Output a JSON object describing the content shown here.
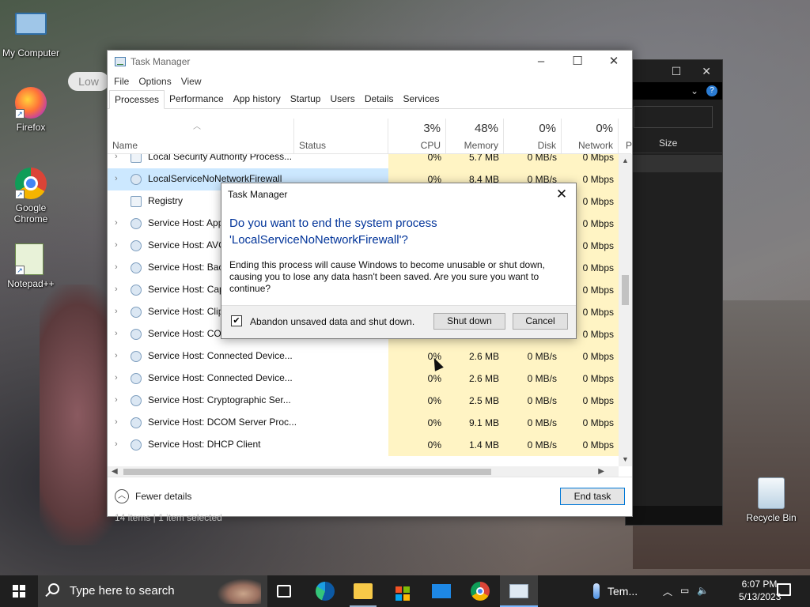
{
  "desktop": {
    "icons": [
      {
        "label": "My Computer",
        "icon": "computer-icon"
      },
      {
        "label": "Firefox",
        "icon": "firefox-icon"
      },
      {
        "label": "Google Chrome",
        "icon": "chrome-icon"
      },
      {
        "label": "Notepad++",
        "icon": "notepad-plus-plus-icon"
      },
      {
        "label": "Recycle Bin",
        "icon": "recycle-bin-icon"
      }
    ],
    "low_pill": "Low"
  },
  "bg_window": {
    "column_header": "Size"
  },
  "task_manager": {
    "title": "Task Manager",
    "menu": [
      "File",
      "Options",
      "View"
    ],
    "tabs": [
      "Processes",
      "Performance",
      "App history",
      "Startup",
      "Users",
      "Details",
      "Services"
    ],
    "active_tab": "Processes",
    "columns": {
      "name": "Name",
      "status": "Status",
      "cpu": {
        "pct": "3%",
        "label": "CPU"
      },
      "memory": {
        "pct": "48%",
        "label": "Memory"
      },
      "disk": {
        "pct": "0%",
        "label": "Disk"
      },
      "network": {
        "pct": "0%",
        "label": "Network"
      },
      "power": "P"
    },
    "rows": [
      {
        "name": "Local Security Authority Process...",
        "cpu": "0%",
        "memory": "5.7 MB",
        "disk": "0 MB/s",
        "network": "0 Mbps"
      },
      {
        "name": "LocalServiceNoNetworkFirewall",
        "cpu": "0%",
        "memory": "8.4 MB",
        "disk": "0 MB/s",
        "network": "0 Mbps"
      },
      {
        "name": "Registry",
        "cpu": "",
        "memory": "",
        "disk": "",
        "network": "0 Mbps"
      },
      {
        "name": "Service Host: App",
        "cpu": "",
        "memory": "",
        "disk": "",
        "network": "0 Mbps"
      },
      {
        "name": "Service Host: AVC",
        "cpu": "",
        "memory": "",
        "disk": "",
        "network": "0 Mbps"
      },
      {
        "name": "Service Host: Bac",
        "cpu": "",
        "memory": "",
        "disk": "",
        "network": "0 Mbps"
      },
      {
        "name": "Service Host: Cap",
        "cpu": "",
        "memory": "",
        "disk": "",
        "network": "0 Mbps"
      },
      {
        "name": "Service Host: Clip",
        "cpu": "",
        "memory": "",
        "disk": "",
        "network": "0 Mbps"
      },
      {
        "name": "Service Host: COM",
        "cpu": "",
        "memory": "",
        "disk": "",
        "network": "0 Mbps"
      },
      {
        "name": "Service Host: Connected Device...",
        "cpu": "0%",
        "memory": "2.6 MB",
        "disk": "0 MB/s",
        "network": "0 Mbps"
      },
      {
        "name": "Service Host: Connected Device...",
        "cpu": "0%",
        "memory": "2.6 MB",
        "disk": "0 MB/s",
        "network": "0 Mbps"
      },
      {
        "name": "Service Host: Cryptographic Ser...",
        "cpu": "0%",
        "memory": "2.5 MB",
        "disk": "0 MB/s",
        "network": "0 Mbps"
      },
      {
        "name": "Service Host: DCOM Server Proc...",
        "cpu": "0%",
        "memory": "9.1 MB",
        "disk": "0 MB/s",
        "network": "0 Mbps"
      },
      {
        "name": "Service Host: DHCP Client",
        "cpu": "0%",
        "memory": "1.4 MB",
        "disk": "0 MB/s",
        "network": "0 Mbps"
      }
    ],
    "footer": {
      "fewer_details": "Fewer details",
      "end_task": "End task"
    },
    "status_bar": "14 items  |  1 item selected"
  },
  "dialog": {
    "title": "Task Manager",
    "question": "Do you want to end the system process 'LocalServiceNoNetworkFirewall'?",
    "body": "Ending this process will cause Windows to become unusable or shut down, causing you to lose any data hasn't been saved. Are you sure you want to continue?",
    "checkbox_label": "Abandon unsaved data and shut down.",
    "checkbox_checked": true,
    "shutdown_label": "Shut down",
    "cancel_label": "Cancel"
  },
  "taskbar": {
    "search_placeholder": "Type here to search",
    "weather_label": "Tem...",
    "time": "6:07 PM",
    "date": "5/13/2023"
  }
}
